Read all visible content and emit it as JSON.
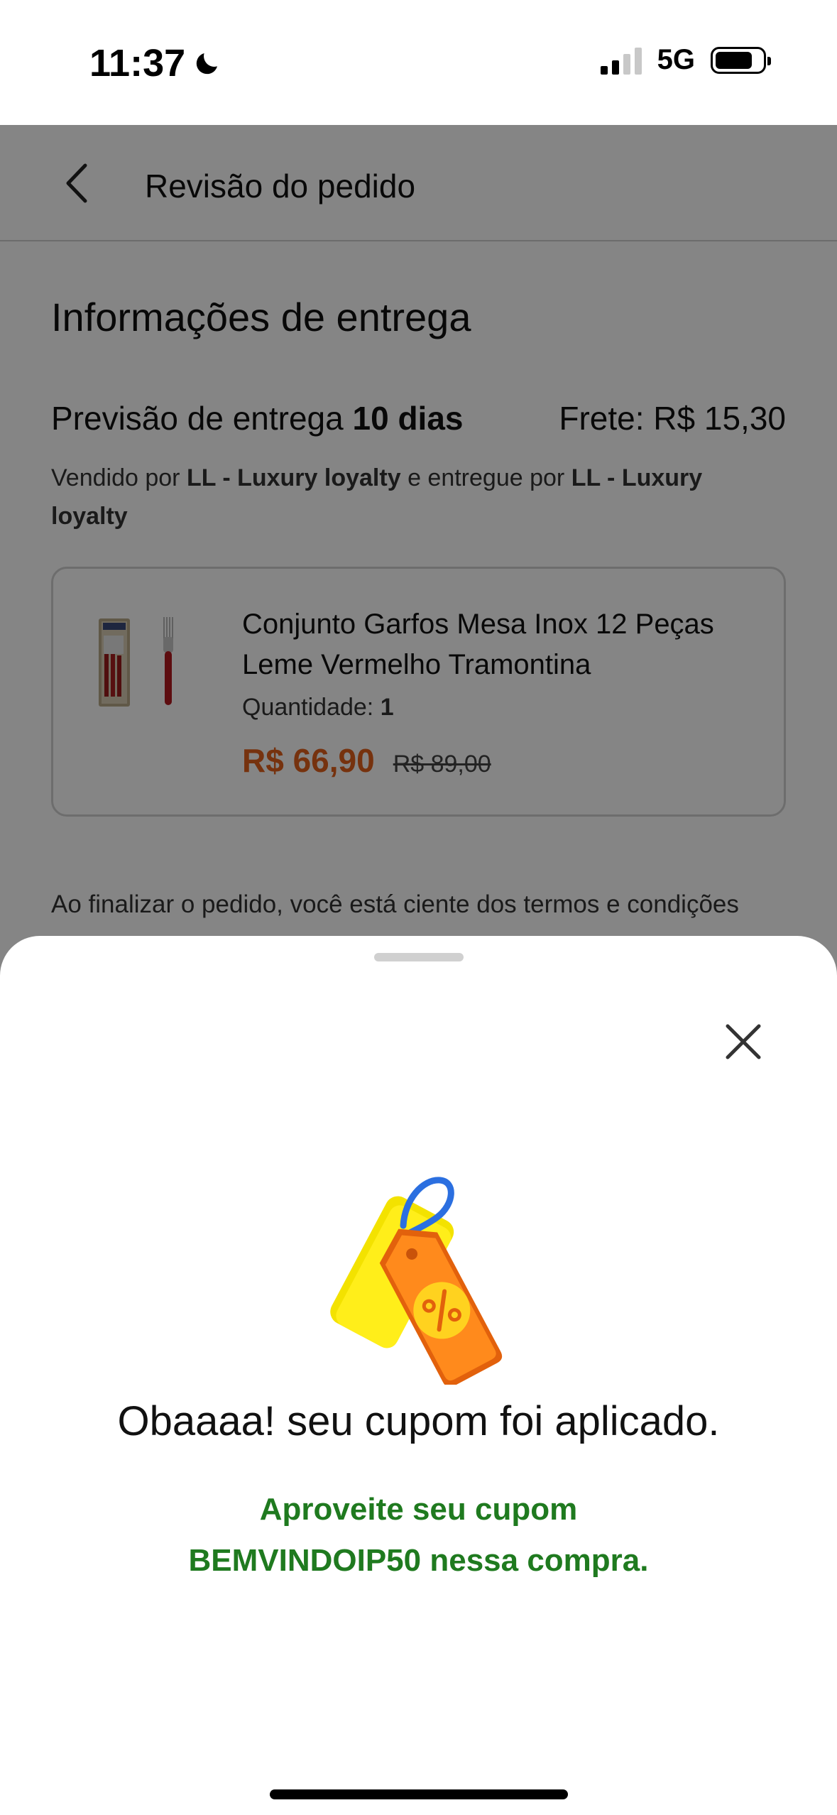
{
  "status_bar": {
    "time": "11:37",
    "network": "5G",
    "icons": [
      "moon-icon",
      "signal-icon",
      "battery-icon"
    ]
  },
  "header": {
    "back_icon": "chevron-left-icon",
    "title": "Revisão do pedido"
  },
  "delivery": {
    "section_title": "Informações de entrega",
    "forecast_label": "Previsão de entrega",
    "forecast_value": "10 dias",
    "shipping": "Frete: R$ 15,30",
    "sold_by_prefix": "Vendido por",
    "sold_by": "LL - Luxury loyalty",
    "delivered_by_prefix": "e entregue por",
    "delivered_by": "LL - Luxury loyalty"
  },
  "product": {
    "name": "Conjunto Garfos Mesa Inox 12 Peças Leme Vermelho Tramontina",
    "quantity_label": "Quantidade:",
    "quantity_value": "1",
    "price": "R$ 66,90",
    "old_price": "R$ 89,00"
  },
  "terms": {
    "text": "Ao finalizar o pedido, você está ciente dos termos e condições"
  },
  "sheet": {
    "close_icon": "close-icon",
    "illustration_icon": "coupon-tags-icon",
    "title": "Obaaaa! seu cupom foi aplicado.",
    "message_line1": "Aproveite seu cupom",
    "message_line2": "BEMVINDOIP50 nessa compra."
  },
  "colors": {
    "price": "#e2611b",
    "success_text": "#1f7a1f",
    "overlay": "rgba(0,0,0,0.48)"
  }
}
